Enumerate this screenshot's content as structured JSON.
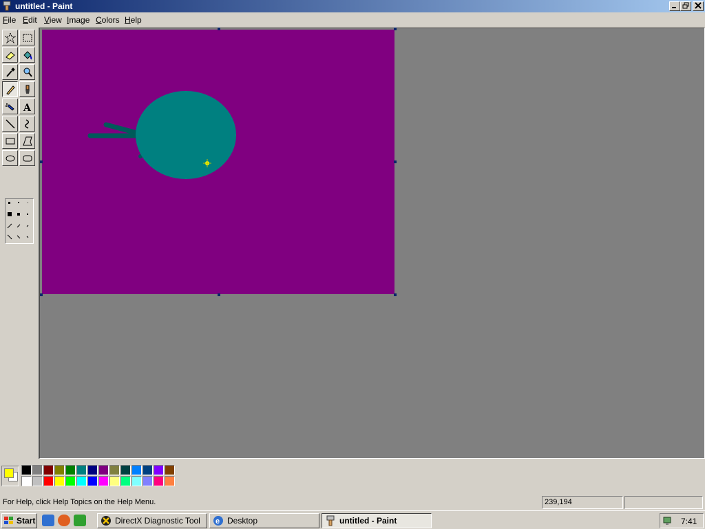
{
  "window": {
    "title": "untitled - Paint"
  },
  "menu": [
    {
      "pre": "",
      "ul": "F",
      "post": "ile"
    },
    {
      "pre": "",
      "ul": "E",
      "post": "dit"
    },
    {
      "pre": "",
      "ul": "V",
      "post": "iew"
    },
    {
      "pre": "",
      "ul": "I",
      "post": "mage"
    },
    {
      "pre": "",
      "ul": "C",
      "post": "olors"
    },
    {
      "pre": "",
      "ul": "H",
      "post": "elp"
    }
  ],
  "tools": [
    {
      "name": "free-form-select",
      "icon": "star-select-icon"
    },
    {
      "name": "rect-select",
      "icon": "rect-select-icon"
    },
    {
      "name": "eraser",
      "icon": "eraser-icon"
    },
    {
      "name": "fill",
      "icon": "paint-bucket-icon"
    },
    {
      "name": "pick-color",
      "icon": "eyedropper-icon"
    },
    {
      "name": "magnifier",
      "icon": "magnifier-icon"
    },
    {
      "name": "pencil",
      "icon": "pencil-icon",
      "active": true
    },
    {
      "name": "brush",
      "icon": "brush-icon"
    },
    {
      "name": "airbrush",
      "icon": "airbrush-icon"
    },
    {
      "name": "text",
      "icon": "text-icon"
    },
    {
      "name": "line",
      "icon": "line-icon"
    },
    {
      "name": "curve",
      "icon": "curve-icon"
    },
    {
      "name": "rectangle",
      "icon": "rectangle-icon"
    },
    {
      "name": "polygon",
      "icon": "polygon-icon"
    },
    {
      "name": "ellipse",
      "icon": "ellipse-icon"
    },
    {
      "name": "rounded-rectangle",
      "icon": "rounded-rect-icon"
    }
  ],
  "canvas": {
    "background": "#800080",
    "ellipse_color": "#008080",
    "stroke_color": "#005a5a",
    "cursor_color": "#ffff00"
  },
  "palette": {
    "foreground": "#ffff00",
    "background": "#ffffff",
    "row1": [
      "#000000",
      "#808080",
      "#800000",
      "#808000",
      "#008000",
      "#008080",
      "#000080",
      "#800080",
      "#808040",
      "#004040",
      "#0080ff",
      "#004080",
      "#8000ff",
      "#804000"
    ],
    "row2": [
      "#ffffff",
      "#c0c0c0",
      "#ff0000",
      "#ffff00",
      "#00ff00",
      "#00ffff",
      "#0000ff",
      "#ff00ff",
      "#ffff80",
      "#00ff80",
      "#80ffff",
      "#8080ff",
      "#ff0080",
      "#ff8040"
    ]
  },
  "status": {
    "help": "For Help, click Help Topics on the Help Menu.",
    "coords": "239,194",
    "size": ""
  },
  "taskbar": {
    "start": "Start",
    "tasks": [
      "DirectX Diagnostic Tool",
      "Desktop",
      "untitled - Paint"
    ],
    "clock": "7:41"
  }
}
